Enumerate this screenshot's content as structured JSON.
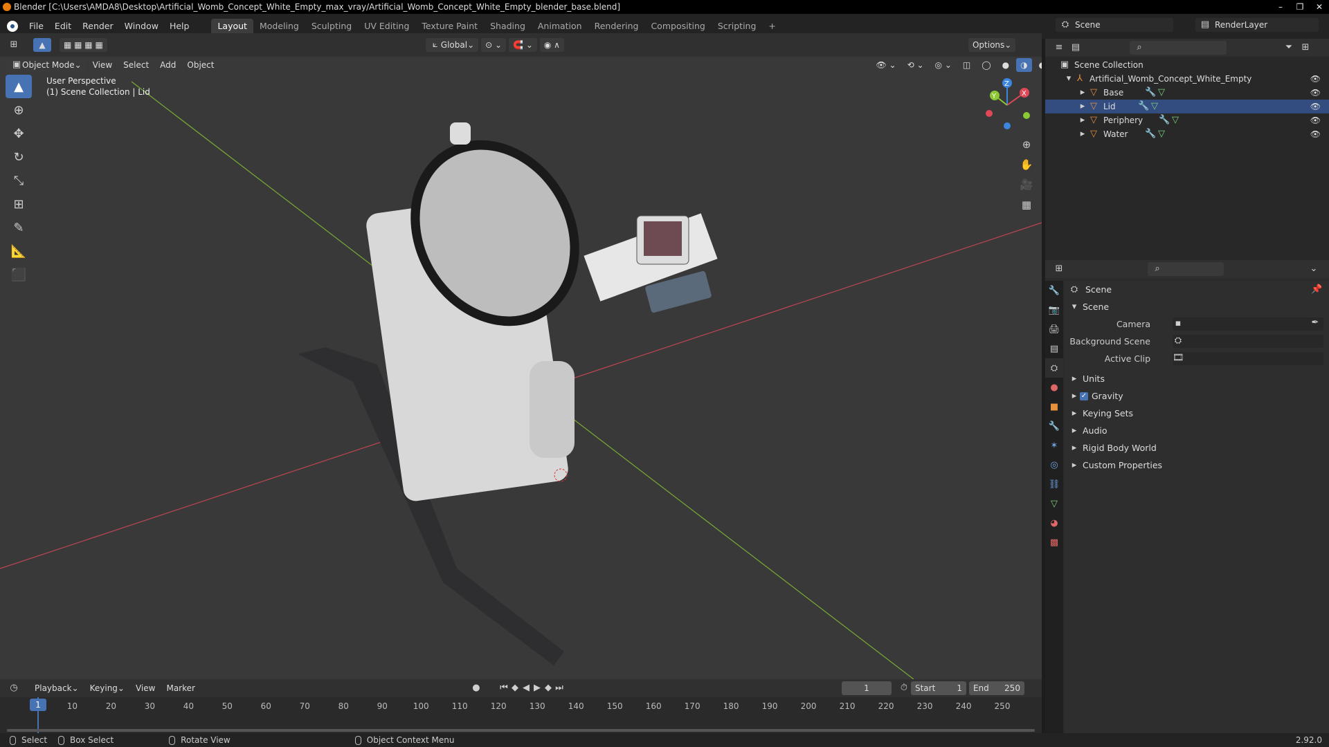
{
  "window": {
    "title": "Blender [C:\\Users\\AMDA8\\Desktop\\Artificial_Womb_Concept_White_Empty_max_vray/Artificial_Womb_Concept_White_Empty_blender_base.blend]",
    "controls": [
      "–",
      "❐",
      "✕"
    ]
  },
  "menu": [
    "File",
    "Edit",
    "Render",
    "Window",
    "Help"
  ],
  "workspaces": [
    "Layout",
    "Modeling",
    "Sculpting",
    "UV Editing",
    "Texture Paint",
    "Shading",
    "Animation",
    "Rendering",
    "Compositing",
    "Scripting"
  ],
  "active_workspace": "Layout",
  "scene_name": "Scene",
  "render_layer": "RenderLayer",
  "viewport": {
    "mode": "Object Mode",
    "menus": [
      "View",
      "Select",
      "Add",
      "Object"
    ],
    "transform": "Global",
    "options": "Options",
    "perspective": "User Perspective",
    "collection_info": "(1) Scene Collection | Lid",
    "gizmo": {
      "z": "Z",
      "y": "Y",
      "x": "X"
    }
  },
  "outliner": {
    "root": "Scene Collection",
    "collection": "Artificial_Womb_Concept_White_Empty",
    "objects": [
      "Base",
      "Lid",
      "Periphery",
      "Water"
    ]
  },
  "properties": {
    "header": "Scene",
    "panel": "Scene",
    "fields": [
      {
        "label": "Camera"
      },
      {
        "label": "Background Scene"
      },
      {
        "label": "Active Clip"
      }
    ],
    "sections": [
      "Units",
      "Gravity",
      "Keying Sets",
      "Audio",
      "Rigid Body World",
      "Custom Properties"
    ],
    "gravity_checked": true
  },
  "timeline": {
    "menus": [
      "Playback",
      "Keying",
      "View",
      "Marker"
    ],
    "current_frame": "1",
    "start_label": "Start",
    "start": "1",
    "end_label": "End",
    "end": "250",
    "ticks": [
      1,
      10,
      20,
      30,
      40,
      50,
      60,
      70,
      80,
      90,
      100,
      110,
      120,
      130,
      140,
      150,
      160,
      170,
      180,
      190,
      200,
      210,
      220,
      230,
      240,
      250
    ]
  },
  "status": {
    "select": "Select",
    "box_select": "Box Select",
    "rotate": "Rotate View",
    "context": "Object Context Menu",
    "version": "2.92.0"
  },
  "colors": {
    "accent": "#4772b3",
    "x_axis": "#e04858",
    "y_axis": "#8bc834",
    "z_axis": "#3d86e0",
    "object_icon": "#e8913b"
  }
}
